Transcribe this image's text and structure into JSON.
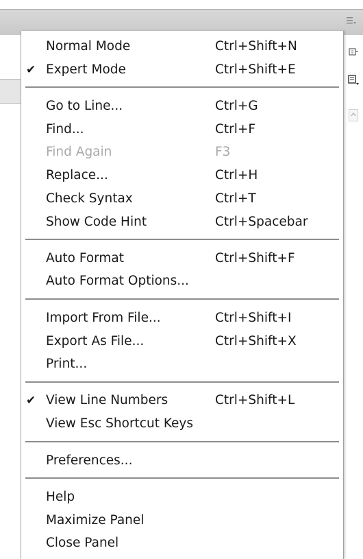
{
  "menu": {
    "items": [
      {
        "label": "Normal Mode",
        "shortcut": "Ctrl+Shift+N",
        "check": ""
      },
      {
        "label": "Expert Mode",
        "shortcut": "Ctrl+Shift+E",
        "check": "✔"
      },
      {
        "label": "Go to Line...",
        "shortcut": "Ctrl+G",
        "check": ""
      },
      {
        "label": "Find...",
        "shortcut": "Ctrl+F",
        "check": ""
      },
      {
        "label": "Find Again",
        "shortcut": "F3",
        "check": ""
      },
      {
        "label": "Replace...",
        "shortcut": "Ctrl+H",
        "check": ""
      },
      {
        "label": "Check Syntax",
        "shortcut": "Ctrl+T",
        "check": ""
      },
      {
        "label": "Show Code Hint",
        "shortcut": "Ctrl+Spacebar",
        "check": ""
      },
      {
        "label": "Auto Format",
        "shortcut": "Ctrl+Shift+F",
        "check": ""
      },
      {
        "label": "Auto Format Options...",
        "shortcut": "",
        "check": ""
      },
      {
        "label": "Import From File...",
        "shortcut": "Ctrl+Shift+I",
        "check": ""
      },
      {
        "label": "Export As File...",
        "shortcut": "Ctrl+Shift+X",
        "check": ""
      },
      {
        "label": "Print...",
        "shortcut": "",
        "check": ""
      },
      {
        "label": "View Line Numbers",
        "shortcut": "Ctrl+Shift+L",
        "check": "✔"
      },
      {
        "label": "View Esc Shortcut Keys",
        "shortcut": "",
        "check": ""
      },
      {
        "label": "Preferences...",
        "shortcut": "",
        "check": ""
      },
      {
        "label": "Help",
        "shortcut": "",
        "check": ""
      },
      {
        "label": "Maximize Panel",
        "shortcut": "",
        "check": ""
      },
      {
        "label": "Close Panel",
        "shortcut": "",
        "check": ""
      }
    ],
    "disabled_color": "#a9a9a9",
    "text_color": "#1a1a1a"
  },
  "panel": {
    "options_icon": "panel-options-icon",
    "toolbar_icons": [
      "pin-icon",
      "view-options-icon",
      "scroll-up-icon"
    ]
  }
}
